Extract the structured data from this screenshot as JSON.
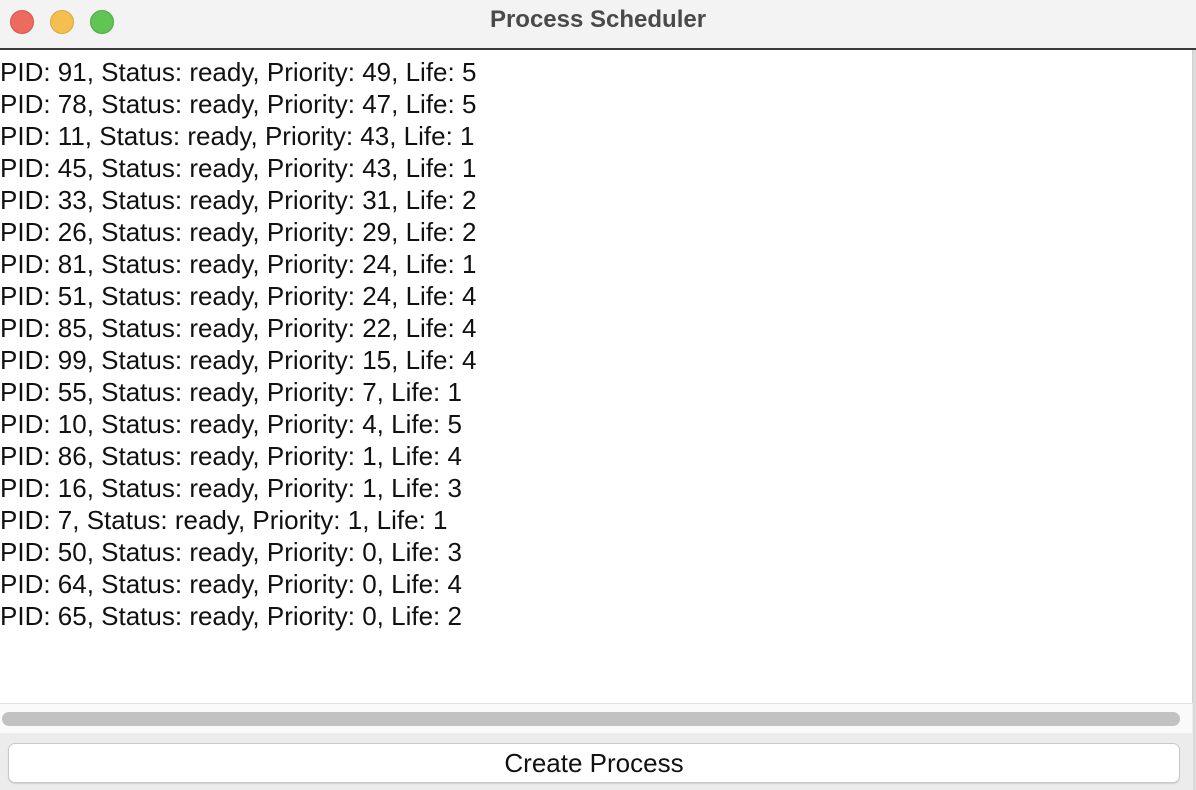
{
  "window": {
    "title": "Process Scheduler"
  },
  "processes": [
    "PID: 91, Status: ready, Priority: 49, Life: 5",
    "PID: 78, Status: ready, Priority: 47, Life: 5",
    "PID: 11, Status: ready, Priority: 43, Life: 1",
    "PID: 45, Status: ready, Priority: 43, Life: 1",
    "PID: 33, Status: ready, Priority: 31, Life: 2",
    "PID: 26, Status: ready, Priority: 29, Life: 2",
    "PID: 81, Status: ready, Priority: 24, Life: 1",
    "PID: 51, Status: ready, Priority: 24, Life: 4",
    "PID: 85, Status: ready, Priority: 22, Life: 4",
    "PID: 99, Status: ready, Priority: 15, Life: 4",
    "PID: 55, Status: ready, Priority: 7, Life: 1",
    "PID: 10, Status: ready, Priority: 4, Life: 5",
    "PID: 86, Status: ready, Priority: 1, Life: 4",
    "PID: 16, Status: ready, Priority: 1, Life: 3",
    "PID: 7, Status: ready, Priority: 1, Life: 1",
    "PID: 50, Status: ready, Priority: 0, Life: 3",
    "PID: 64, Status: ready, Priority: 0, Life: 4",
    "PID: 65, Status: ready, Priority: 0, Life: 2"
  ],
  "actions": {
    "create_label": "Create Process"
  },
  "colors": {
    "close": "#ed6a5e",
    "minimize": "#f5bf4f",
    "maximize": "#61c554"
  }
}
